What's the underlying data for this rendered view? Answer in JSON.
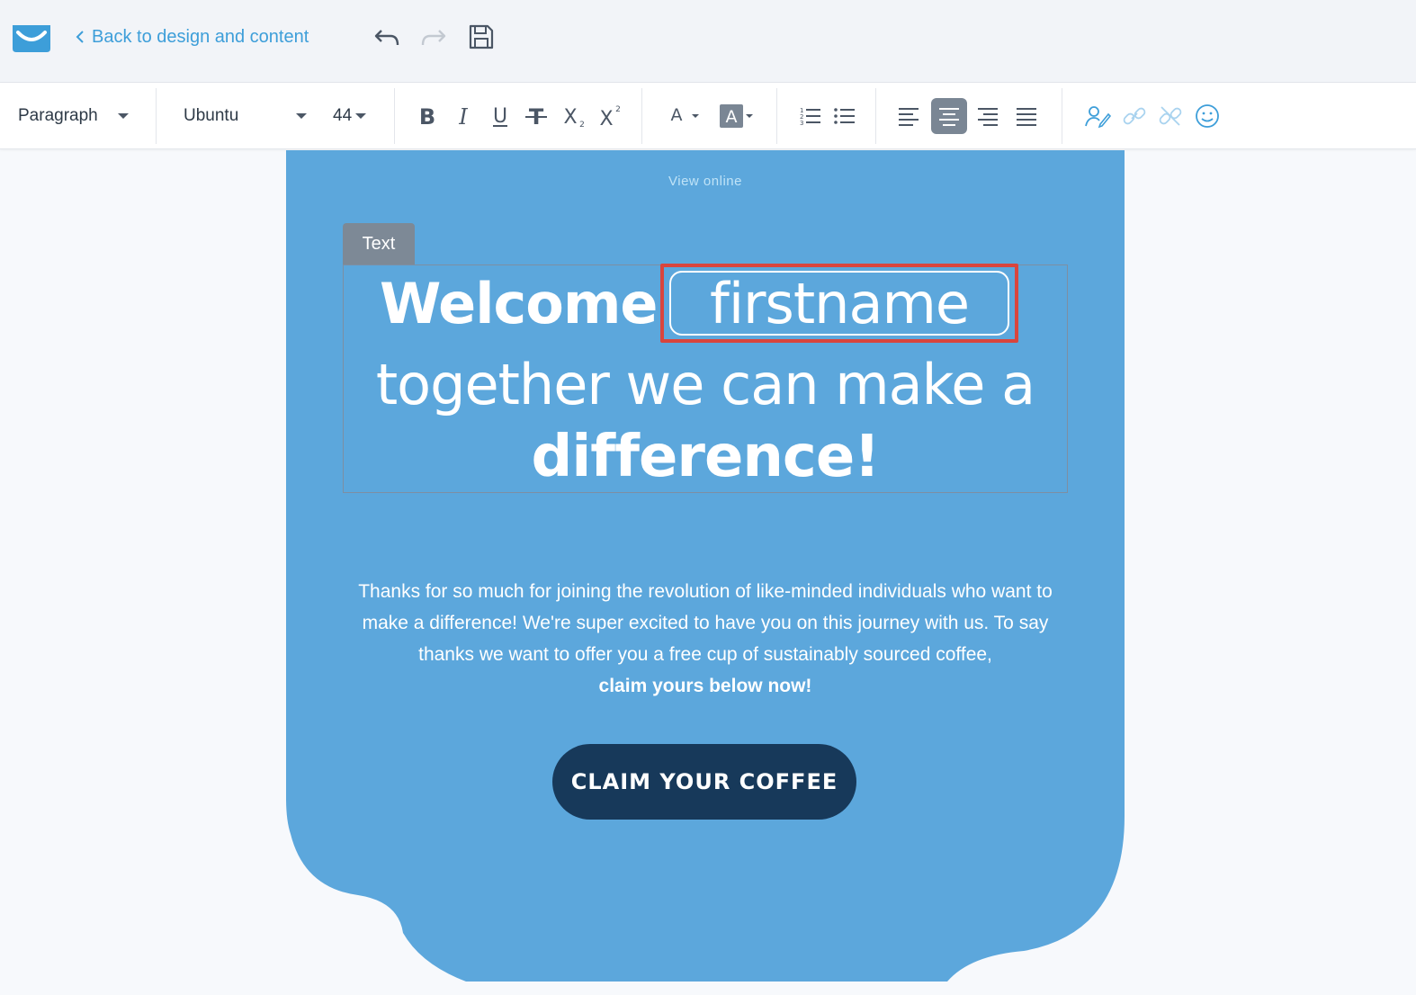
{
  "topbar": {
    "back_label": "Back to design and content",
    "logo_icon": "getresponse-logo-icon",
    "undo_icon": "undo-icon",
    "redo_icon": "redo-icon",
    "save_icon": "save-icon"
  },
  "toolbar": {
    "block_format": "Paragraph",
    "font_family": "Ubuntu",
    "font_size": "44",
    "buttons": [
      "bold-icon",
      "italic-icon",
      "underline-icon",
      "strikethrough-icon",
      "subscript-icon",
      "superscript-icon",
      "font-color-icon",
      "highlight-color-icon",
      "ordered-list-icon",
      "unordered-list-icon",
      "align-left-icon",
      "align-center-icon",
      "align-right-icon",
      "align-justify-icon",
      "personalize-icon",
      "link-icon",
      "unlink-icon",
      "emoji-icon"
    ],
    "active_alignment": "center"
  },
  "email": {
    "view_online": "View online",
    "block_tag": "Text",
    "headline": {
      "welcome": "Welcome",
      "firstname": "firstname",
      "line2": "together we can make a",
      "line3": "difference!"
    },
    "body": {
      "text": "Thanks for so much for joining the revolution of like-minded individuals who want to make a difference! We're super excited to have you on this journey with us. To say thanks we want to offer you a free cup of sustainably sourced coffee,",
      "strong": "claim yours below now!"
    },
    "cta_label": "CLAIM YOUR COFFEE"
  },
  "colors": {
    "email_bg": "#5ca7dc",
    "cta_bg": "#17395a",
    "accent": "#3d9ed9",
    "selection_border": "#d9453d",
    "active_tool": "#7a8694"
  }
}
